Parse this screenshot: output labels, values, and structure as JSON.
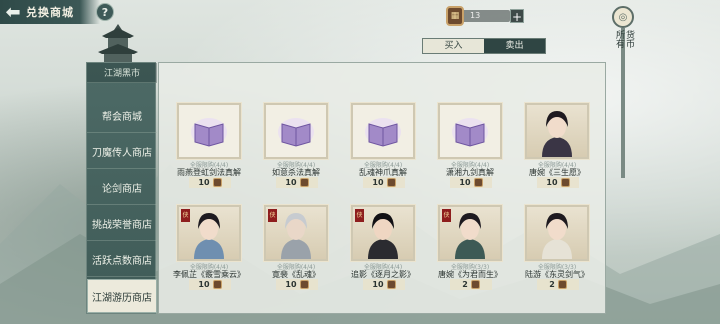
{
  "header": {
    "back_symbol": "⬅",
    "title": "兑换商城",
    "help_symbol": "?"
  },
  "currency": {
    "value": "13",
    "plus": "+"
  },
  "filter": {
    "label_a": "货币",
    "label_b": "所有"
  },
  "tabs": [
    {
      "label": "买入",
      "active": true
    },
    {
      "label": "卖出",
      "active": false
    }
  ],
  "sidebar": {
    "top_label": "江湖黑市",
    "items": [
      {
        "label": "帮会商城",
        "active": false
      },
      {
        "label": "刀魔传人商店",
        "active": false
      },
      {
        "label": "论剑商店",
        "active": false
      },
      {
        "label": "挑战荣誉商店",
        "active": false
      },
      {
        "label": "活跃点数商店",
        "active": false
      },
      {
        "label": "江湖游历商店",
        "active": true
      }
    ]
  },
  "items": [
    {
      "type": "book",
      "limit": "全服限购(4/4)",
      "name": "雨燕登虹剑法真解",
      "price": "10"
    },
    {
      "type": "book",
      "limit": "全服限购(4/4)",
      "name": "如意杀法真解",
      "price": "10"
    },
    {
      "type": "book",
      "limit": "全服限购(4/4)",
      "name": "乱魂神爪真解",
      "price": "10"
    },
    {
      "type": "book",
      "limit": "全服限购(4/4)",
      "name": "潇湘九剑真解",
      "price": "10"
    },
    {
      "type": "char",
      "badge": "",
      "limit": "全服限购(4/4)",
      "name": "唐婉《三生愿》",
      "price": "10"
    },
    {
      "type": "char",
      "badge": "侠",
      "limit": "全服限购(4/4)",
      "name": "李佩芷《霰雪乘云》",
      "price": "10"
    },
    {
      "type": "char",
      "badge": "侠",
      "limit": "全服限购(4/4)",
      "name": "寛裴《乱魂》",
      "price": "10"
    },
    {
      "type": "char",
      "badge": "侠",
      "limit": "全服限购(4/4)",
      "name": "追影《逐月之影》",
      "price": "10"
    },
    {
      "type": "char",
      "badge": "侠",
      "limit": "全服限购(3/3)",
      "name": "唐婉《为君而生》",
      "price": "2"
    },
    {
      "type": "char",
      "badge": "",
      "limit": "全服限购(3/3)",
      "name": "陆游《东灵剑气》",
      "price": "2"
    }
  ],
  "colors": {
    "sidebar": "#4d6a66",
    "active_tab": "#e7e6d8",
    "badge": "#8e1d1d"
  }
}
